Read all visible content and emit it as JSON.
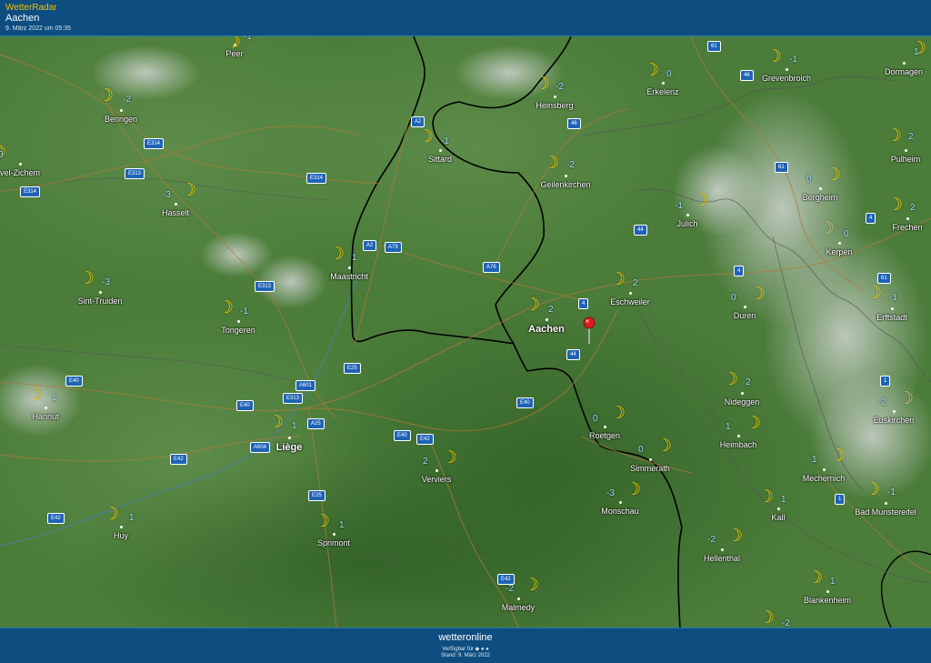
{
  "header": {
    "app_name": "WetterRadar",
    "location": "Aachen",
    "timestamp": "9. März 2022 um 05:35"
  },
  "footer": {
    "brand": "wetteronline",
    "availability": "Verfügbar für",
    "stand": "Stand: 9. März 2022"
  },
  "colors": {
    "header_bg": "#0d4d7f",
    "app_name": "#f2c200",
    "moon": "#f6d100",
    "temperature": "#9be0ff",
    "border": "#000000",
    "road_badge": "#1e63b5"
  },
  "icons": {
    "night": "crescent-moon-icon",
    "location": "map-pin-icon"
  },
  "cities": [
    {
      "name": "Peer",
      "temp": "-1"
    },
    {
      "name": "Beringen",
      "temp": "-2"
    },
    {
      "name": "Heinsberg",
      "temp": "-2"
    },
    {
      "name": "Erkelenz",
      "temp": "0"
    },
    {
      "name": "Grevenbroich",
      "temp": "-1"
    },
    {
      "name": "Dormagen",
      "temp": "1"
    },
    {
      "name": "Sittard",
      "temp": "-1"
    },
    {
      "name": "Pulheim",
      "temp": "2"
    },
    {
      "name": "Geilenkirchen",
      "temp": "-2"
    },
    {
      "name": "Bergheim",
      "temp": "0"
    },
    {
      "name": "vel-Zichem",
      "temp": "0"
    },
    {
      "name": "Hasselt",
      "temp": "-3"
    },
    {
      "name": "Julich",
      "temp": "-1"
    },
    {
      "name": "Frechen",
      "temp": "2"
    },
    {
      "name": "Kerpen",
      "temp": "0"
    },
    {
      "name": "Maastricht",
      "temp": "1"
    },
    {
      "name": "Sint-Truiden",
      "temp": "-3"
    },
    {
      "name": "Eschweiler",
      "temp": "2"
    },
    {
      "name": "Erftstadt",
      "temp": "-1"
    },
    {
      "name": "Tongeren",
      "temp": "-1"
    },
    {
      "name": "Duren",
      "temp": "0"
    },
    {
      "name": "Aachen",
      "temp": "2"
    },
    {
      "name": "Nideggen",
      "temp": "2"
    },
    {
      "name": "Hannut",
      "temp": "1"
    },
    {
      "name": "Euskirchen",
      "temp": "-2"
    },
    {
      "name": "Liège",
      "temp": "1"
    },
    {
      "name": "Roetgen",
      "temp": "0"
    },
    {
      "name": "Heimbach",
      "temp": "1"
    },
    {
      "name": "Verviers",
      "temp": "2"
    },
    {
      "name": "Simmerath",
      "temp": "0"
    },
    {
      "name": "Mechernich",
      "temp": "1"
    },
    {
      "name": "Monschau",
      "temp": "-3"
    },
    {
      "name": "Kall",
      "temp": "1"
    },
    {
      "name": "Bad Munstereifel",
      "temp": "-1"
    },
    {
      "name": "Huy",
      "temp": "1"
    },
    {
      "name": "Sprimont",
      "temp": "1"
    },
    {
      "name": "Hellenthal",
      "temp": "-2"
    },
    {
      "name": "Blankenheim",
      "temp": "1"
    },
    {
      "name": "Malmedy",
      "temp": "-2"
    },
    {
      "name": "",
      "temp": "-2"
    }
  ],
  "roads": [
    "61",
    "46",
    "A2",
    "46",
    "E314",
    "E313",
    "61",
    "E314",
    "E314",
    "44",
    "4",
    "A2",
    "A79",
    "A76",
    "4",
    "E313",
    "4",
    "61",
    "E25",
    "A601",
    "E40",
    "E313",
    "E40",
    "A25",
    "44",
    "E40",
    "E40",
    "E42",
    "A604",
    "E42",
    "1",
    "E25",
    "E42",
    "1",
    "E42"
  ]
}
